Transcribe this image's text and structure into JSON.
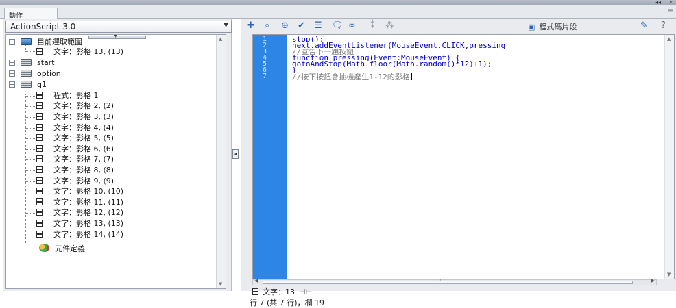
{
  "panel": {
    "tab_title": "動作",
    "menu_glyph": "≡"
  },
  "script_version": "ActionScript 3.0",
  "tree": {
    "current_selection": {
      "label": "目前選取範圍",
      "child": "文字：影格 13, (13)"
    },
    "scenes": [
      "start",
      "option",
      "q1"
    ],
    "q1_items": [
      "程式：影格 1",
      "文字：影格 2, (2)",
      "文字：影格 3, (3)",
      "文字：影格 4, (4)",
      "文字：影格 5, (5)",
      "文字：影格 6, (6)",
      "文字：影格 7, (7)",
      "文字：影格 8, (8)",
      "文字：影格 9, (9)",
      "文字：影格 10, (10)",
      "文字：影格 11, (11)",
      "文字：影格 12, (12)",
      "文字：影格 13, (13)",
      "文字：影格 14, (14)"
    ],
    "component_definitions": "元件定義"
  },
  "toolbar": {
    "snippets_label": "程式碼片段"
  },
  "editor": {
    "line_numbers": [
      "1",
      "2",
      "3",
      "4",
      "5",
      "6",
      "7"
    ],
    "lines": [
      "stop();",
      "next.addEventListener(MouseEvent.CLICK,pressing",
      "//宣告下一題按鈕",
      "function pressing(Event:MouseEvent) {",
      "gotoAndStop(Math.floor(Math.random()*12)+1);",
      "}",
      "//按下按鈕會抽機產生1-12的影格"
    ]
  },
  "status": {
    "tab_label": "文字：13",
    "position": "行 7 (共 7 行)，欄 19"
  },
  "colors": {
    "gutter": "#2d86e6",
    "code_keyword": "#0000c8",
    "comment": "#7d7d7d"
  }
}
